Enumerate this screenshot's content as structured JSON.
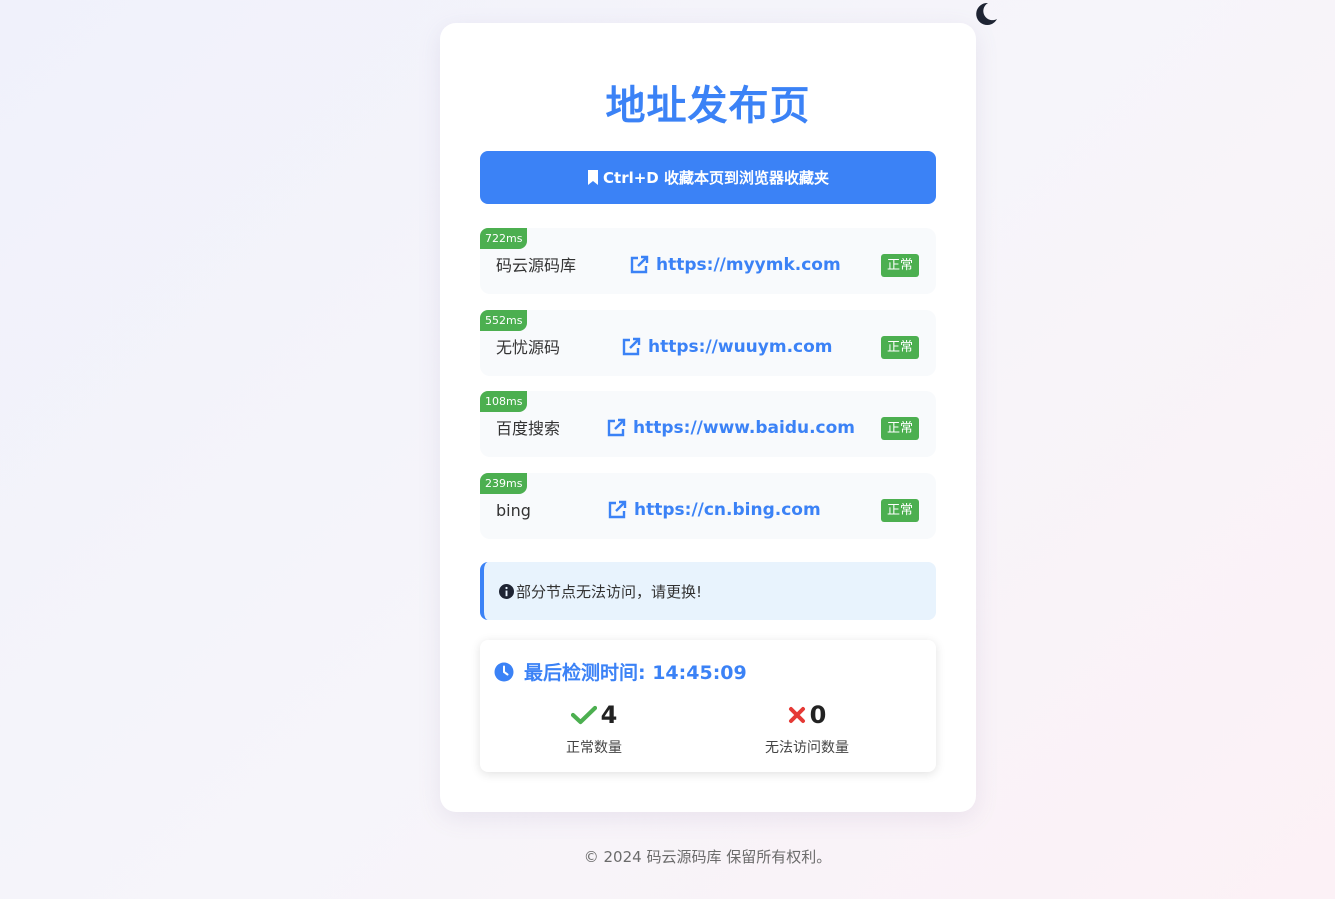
{
  "theme_toggle": {
    "icon": "moon-icon"
  },
  "page": {
    "title": "地址发布页"
  },
  "bookmark": {
    "label": "Ctrl+D 收藏本页到浏览器收藏夹",
    "icon": "bookmark-icon"
  },
  "links": [
    {
      "latency": "722ms",
      "name": "码云源码库",
      "url": "https://myymk.com",
      "status": "正常"
    },
    {
      "latency": "552ms",
      "name": "无忧源码",
      "url": "https://wuuym.com",
      "status": "正常"
    },
    {
      "latency": "108ms",
      "name": "百度搜索",
      "url": "https://www.baidu.com",
      "status": "正常"
    },
    {
      "latency": "239ms",
      "name": "bing",
      "url": "https://cn.bing.com",
      "status": "正常"
    }
  ],
  "notice": {
    "text": "部分节点无法访问，请更换!",
    "icon": "info-circle-icon"
  },
  "stats": {
    "check_time": "最后检测时间: 14:45:09",
    "ok_count": "4",
    "ok_label": "正常数量",
    "fail_count": "0",
    "fail_label": "无法访问数量"
  },
  "footer": {
    "text": "© 2024 码云源码库 保留所有权利。"
  },
  "colors": {
    "accent": "#3b82f6",
    "success": "#4caf50",
    "danger": "#e53935"
  }
}
